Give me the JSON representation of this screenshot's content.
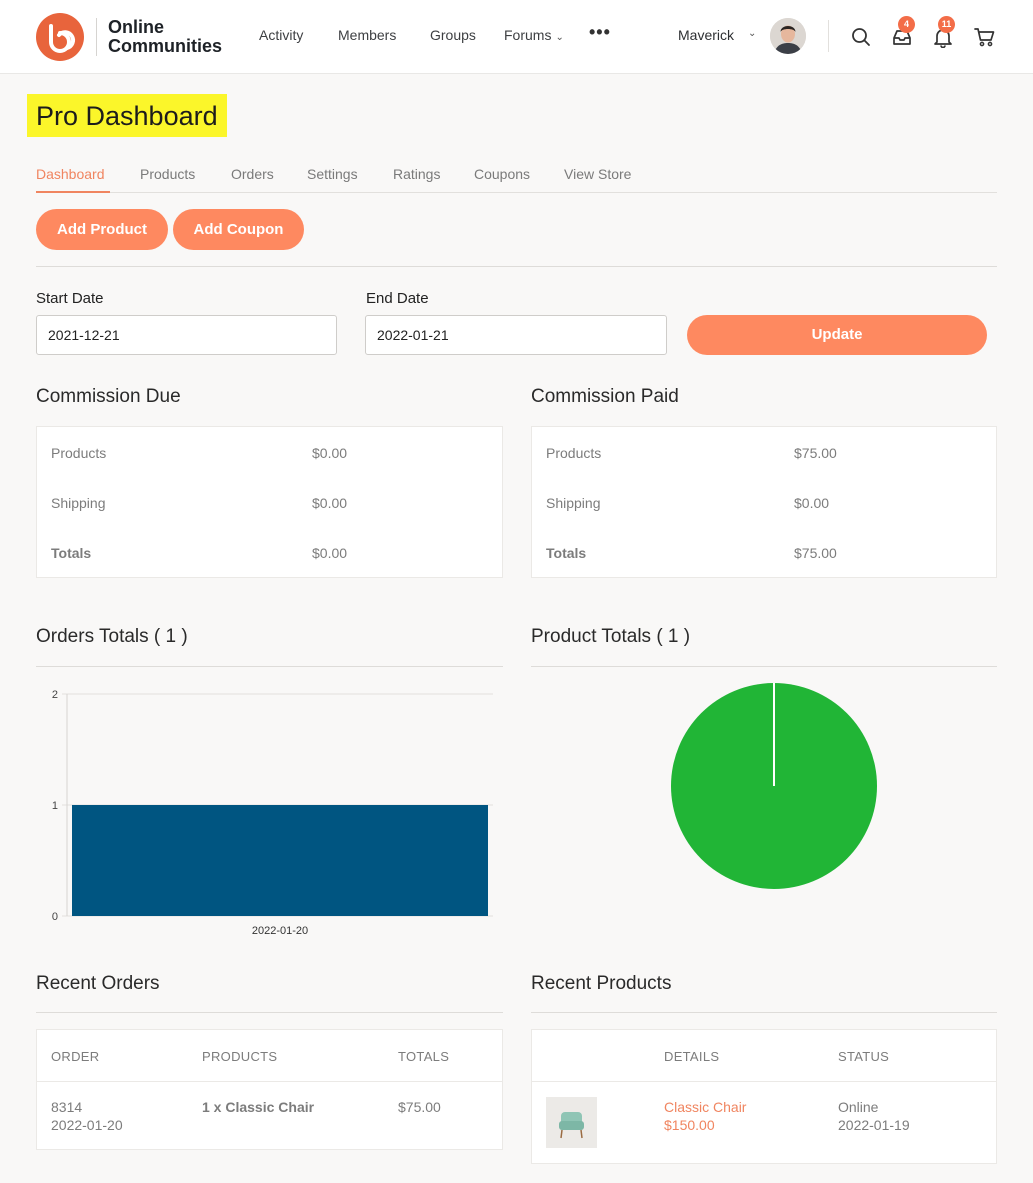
{
  "header": {
    "logo_line1": "Online",
    "logo_line2": "Communities",
    "nav": [
      "Activity",
      "Members",
      "Groups",
      "Forums"
    ],
    "more": "•••",
    "user_name": "Maverick",
    "messages_count": "4",
    "notifications_count": "11",
    "colors": {
      "brand": "#e8643c",
      "badge": "#f36d48"
    }
  },
  "page": {
    "title": "Pro Dashboard"
  },
  "tabs": [
    "Dashboard",
    "Products",
    "Orders",
    "Settings",
    "Ratings",
    "Coupons",
    "View Store"
  ],
  "actions": {
    "add_product": "Add Product",
    "add_coupon": "Add Coupon"
  },
  "date_filter": {
    "start_label": "Start Date",
    "start_value": "2021-12-21",
    "end_label": "End Date",
    "end_value": "2022-01-21",
    "update": "Update"
  },
  "commission_due": {
    "title": "Commission Due",
    "rows": [
      {
        "label": "Products",
        "value": "$0.00"
      },
      {
        "label": "Shipping",
        "value": "$0.00"
      },
      {
        "label": "Totals",
        "value": "$0.00"
      }
    ]
  },
  "commission_paid": {
    "title": "Commission Paid",
    "rows": [
      {
        "label": "Products",
        "value": "$75.00"
      },
      {
        "label": "Shipping",
        "value": "$0.00"
      },
      {
        "label": "Totals",
        "value": "$75.00"
      }
    ]
  },
  "orders_totals": {
    "title": "Orders Totals ( 1 )"
  },
  "product_totals": {
    "title": "Product Totals ( 1 )"
  },
  "chart_data": [
    {
      "type": "bar",
      "categories": [
        "2022-01-20"
      ],
      "values": [
        1
      ],
      "ylim": [
        0,
        2
      ],
      "yticks": [
        "0",
        "1",
        "2"
      ],
      "grid": true,
      "color": "#005581"
    },
    {
      "type": "pie",
      "labels": [
        ""
      ],
      "values": [
        1
      ],
      "color": "#21b536"
    }
  ],
  "recent_orders": {
    "title": "Recent Orders",
    "headers": [
      "ORDER",
      "PRODUCTS",
      "TOTALS"
    ],
    "rows": [
      {
        "order": "8314",
        "date": "2022-01-20",
        "products": "1 x Classic Chair",
        "total": "$75.00"
      }
    ]
  },
  "recent_products": {
    "title": "Recent Products",
    "headers": [
      "DETAILS",
      "STATUS"
    ],
    "rows": [
      {
        "name": "Classic Chair",
        "price": "$150.00",
        "status": "Online",
        "date": "2022-01-19"
      }
    ]
  }
}
